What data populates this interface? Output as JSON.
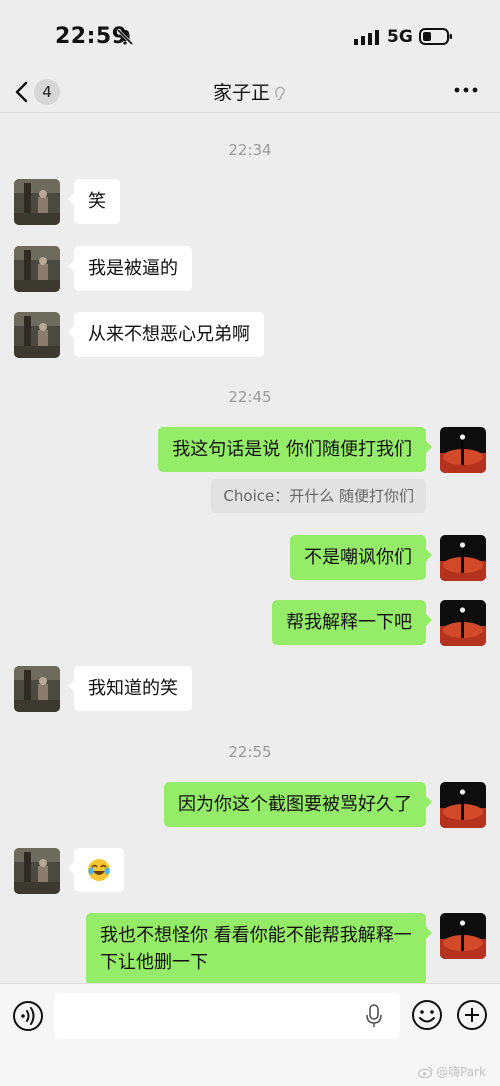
{
  "status_bar": {
    "time": "22:59",
    "network": "5G"
  },
  "nav": {
    "unread_count": "4",
    "title": "家子正"
  },
  "messages": [
    {
      "type": "time",
      "text": "22:34"
    },
    {
      "type": "received",
      "text": "笑"
    },
    {
      "type": "received",
      "text": "我是被逼的"
    },
    {
      "type": "received",
      "text": "从来不想恶心兄弟啊"
    },
    {
      "type": "time",
      "text": "22:45"
    },
    {
      "type": "sent",
      "text": "我这句话是说 你们随便打我们"
    },
    {
      "type": "quote",
      "text": "Choice：开什么 随便打你们"
    },
    {
      "type": "sent",
      "text": "不是嘲讽你们"
    },
    {
      "type": "sent",
      "text": "帮我解释一下吧"
    },
    {
      "type": "received",
      "text": "我知道的笑"
    },
    {
      "type": "time",
      "text": "22:55"
    },
    {
      "type": "sent",
      "text": "因为你这个截图要被骂好久了"
    },
    {
      "type": "received",
      "emoji": "crying-laughing-face-emoji"
    },
    {
      "type": "sent",
      "text": "我也不想怪你 看看你能不能帮我解释一下让他删一下"
    }
  ],
  "input": {
    "value": "",
    "placeholder": ""
  },
  "watermark": {
    "text": "@嗨Park"
  },
  "colors": {
    "sent_bubble": "#95ec69",
    "received_bubble": "#ffffff",
    "background": "#ededed",
    "time_label": "#9a9a9a"
  }
}
